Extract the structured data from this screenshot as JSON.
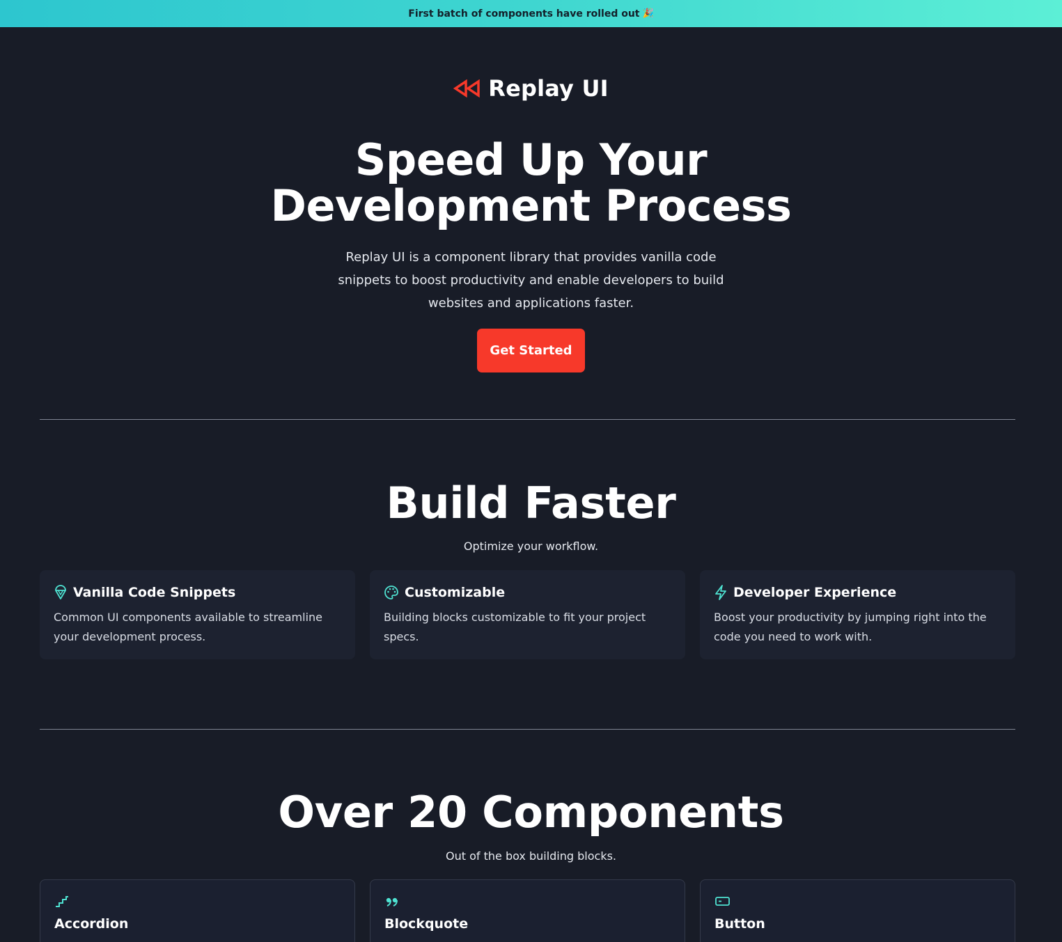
{
  "banner": {
    "text": "First batch of components have rolled out",
    "emoji": "🎉"
  },
  "brand": {
    "name": "Replay UI"
  },
  "hero": {
    "title_line1": "Speed Up Your",
    "title_line2": "Development Process",
    "subtitle": "Replay UI is a component library that provides vanilla code snippets to boost productivity and enable developers to build websites and applications faster.",
    "cta_label": "Get Started"
  },
  "build": {
    "title": "Build Faster",
    "subtitle": "Optimize your workflow.",
    "features": [
      {
        "icon": "ice-cream-icon",
        "title": "Vanilla Code Snippets",
        "desc": "Common UI components available to streamline your development process."
      },
      {
        "icon": "palette-icon",
        "title": "Customizable",
        "desc": "Building blocks customizable to fit your project specs."
      },
      {
        "icon": "lightning-icon",
        "title": "Developer Experience",
        "desc": "Boost your productivity by jumping right into the code you need to work with."
      }
    ]
  },
  "components": {
    "title": "Over 20 Components",
    "subtitle": "Out of the box building blocks.",
    "items": [
      {
        "icon": "stairs-icon",
        "title": "Accordion"
      },
      {
        "icon": "quote-icon",
        "title": "Blockquote"
      },
      {
        "icon": "button-icon",
        "title": "Button"
      }
    ]
  },
  "colors": {
    "accent": "#f7392a",
    "teal": "#4fe3d2",
    "background": "#181c27",
    "card": "#1d2230"
  }
}
